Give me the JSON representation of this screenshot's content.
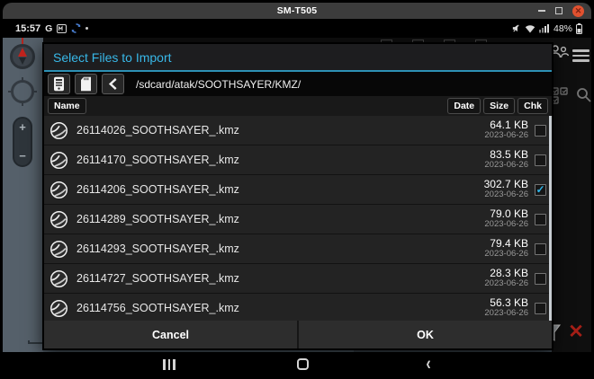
{
  "window": {
    "title": "SM-T505",
    "close_glyph": "✕"
  },
  "status_bar": {
    "time": "15:57",
    "network_type": "G",
    "battery_percent": "48%"
  },
  "dialog": {
    "title": "Select Files to Import",
    "path": "/sdcard/atak/SOOTHSAYER/KMZ/",
    "columns": {
      "name": "Name",
      "date": "Date",
      "size": "Size",
      "chk": "Chk"
    },
    "files": [
      {
        "name": "26114026_SOOTHSAYER_.kmz",
        "size": "64.1 KB",
        "date": "2023-06-26",
        "checked": false
      },
      {
        "name": "26114170_SOOTHSAYER_.kmz",
        "size": "83.5 KB",
        "date": "2023-06-26",
        "checked": false
      },
      {
        "name": "26114206_SOOTHSAYER_.kmz",
        "size": "302.7 KB",
        "date": "2023-06-26",
        "checked": true
      },
      {
        "name": "26114289_SOOTHSAYER_.kmz",
        "size": "79.0 KB",
        "date": "2023-06-26",
        "checked": false
      },
      {
        "name": "26114293_SOOTHSAYER_.kmz",
        "size": "79.4 KB",
        "date": "2023-06-26",
        "checked": false
      },
      {
        "name": "26114727_SOOTHSAYER_.kmz",
        "size": "28.3 KB",
        "date": "2023-06-26",
        "checked": false
      },
      {
        "name": "26114756_SOOTHSAYER_.kmz",
        "size": "56.3 KB",
        "date": "2023-06-26",
        "checked": false
      }
    ],
    "check_glyph": "✓",
    "cancel_label": "Cancel",
    "ok_label": "OK"
  },
  "map_controls": {
    "zoom_in": "+",
    "zoom_out": "−"
  },
  "colors": {
    "accent_blue": "#38b8e8",
    "check_blue": "#2fb6ea",
    "map_gray": "#55606a",
    "close_orange": "#e0512f",
    "delete_red": "#a51f17"
  }
}
